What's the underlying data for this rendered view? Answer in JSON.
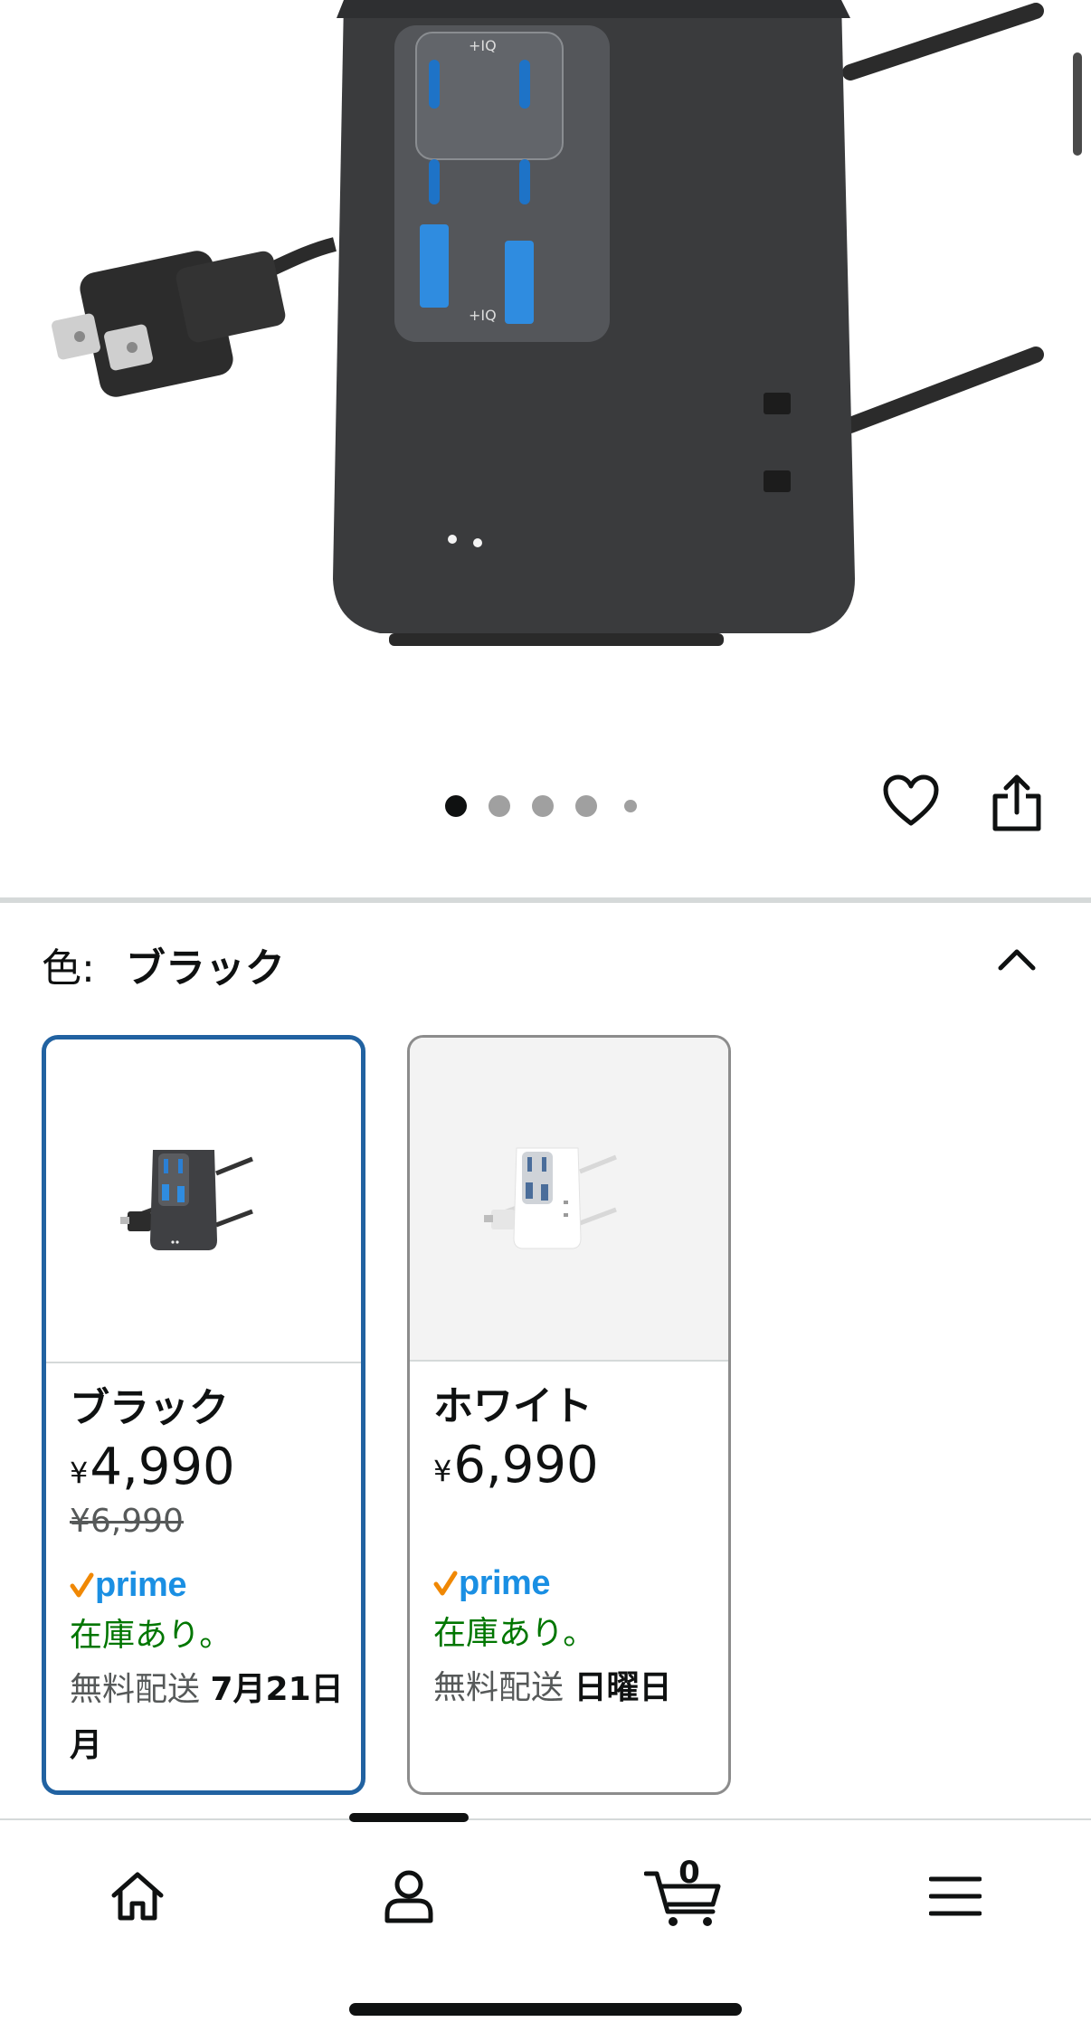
{
  "gallery": {
    "dot_count": 5,
    "active_index": 0
  },
  "color_selector": {
    "label": "色:",
    "selected_value": "ブラック"
  },
  "swatches": [
    {
      "name": "ブラック",
      "currency": "¥",
      "price": "4,990",
      "list_price": "¥6,990",
      "prime": "prime",
      "stock": "在庫あり。",
      "delivery_prefix": "無料配送",
      "delivery_date": "7月21日 月",
      "selected": true
    },
    {
      "name": "ホワイト",
      "currency": "¥",
      "price": "6,990",
      "list_price": "",
      "prime": "prime",
      "stock": "在庫あり。",
      "delivery_prefix": "無料配送",
      "delivery_date": "日曜日",
      "selected": false
    }
  ],
  "bottom_nav": {
    "items": [
      {
        "icon": "home-icon"
      },
      {
        "icon": "account-icon"
      },
      {
        "icon": "cart-icon"
      },
      {
        "icon": "menu-icon"
      }
    ],
    "cart_count": "0"
  },
  "colors": {
    "selected_border": "#2162a1",
    "stock_green": "#007600",
    "prime_blue": "#1a8fe3",
    "prime_check": "#f08804"
  }
}
